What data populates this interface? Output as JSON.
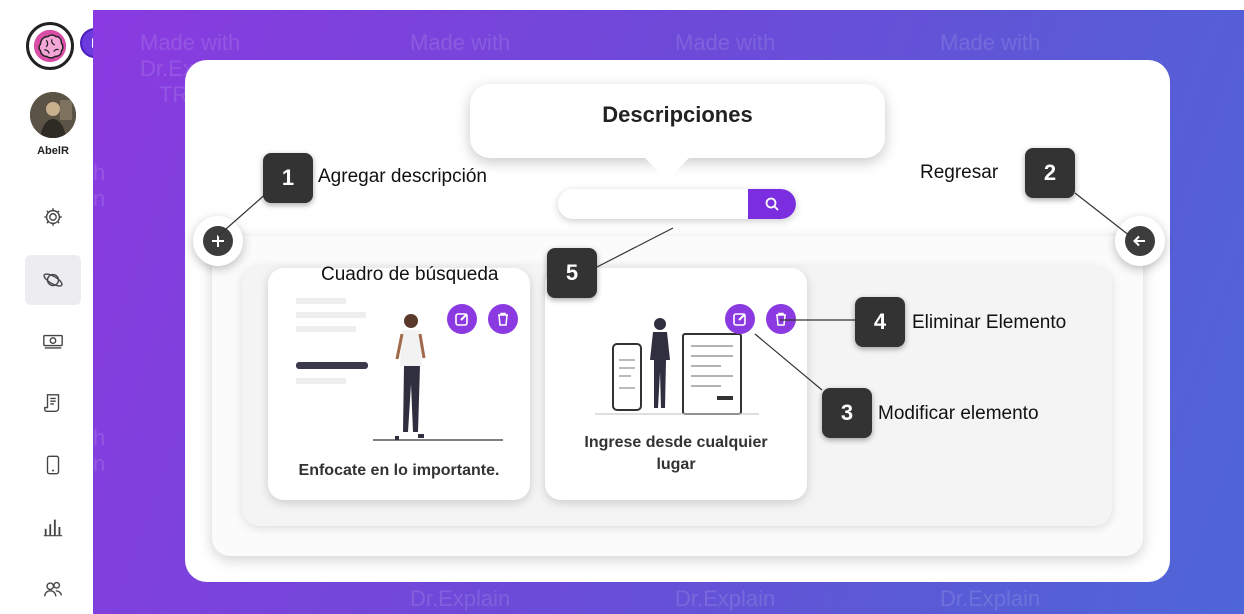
{
  "app": {
    "user_name": "AbelR"
  },
  "watermark": {
    "line1": "Made with",
    "line2": "Dr.Explain",
    "line3": "TRIAL"
  },
  "sidebar": {
    "items": [
      {
        "icon": "gear-icon"
      },
      {
        "icon": "planet-icon",
        "active": true
      },
      {
        "icon": "money-icon"
      },
      {
        "icon": "receipt-icon"
      },
      {
        "icon": "mobile-icon"
      },
      {
        "icon": "bar-chart-icon"
      },
      {
        "icon": "users-icon"
      }
    ]
  },
  "main": {
    "title": "Descripciones",
    "search": {
      "value": "",
      "placeholder": ""
    },
    "cards": [
      {
        "caption": "Enfocate en lo importante."
      },
      {
        "caption": "Ingrese desde cualquier lugar"
      }
    ]
  },
  "callouts": [
    {
      "number": "1",
      "label": "Agregar descripción"
    },
    {
      "number": "2",
      "label": "Regresar"
    },
    {
      "number": "3",
      "label": "Modificar elemento"
    },
    {
      "number": "4",
      "label": "Eliminar Elemento"
    },
    {
      "number": "5",
      "label": "Cuadro de búsqueda"
    }
  ],
  "colors": {
    "accent": "#8a3ae0",
    "gradient_start": "#8a3ae0",
    "gradient_end": "#4f66d8",
    "callout_bg": "#333333"
  }
}
